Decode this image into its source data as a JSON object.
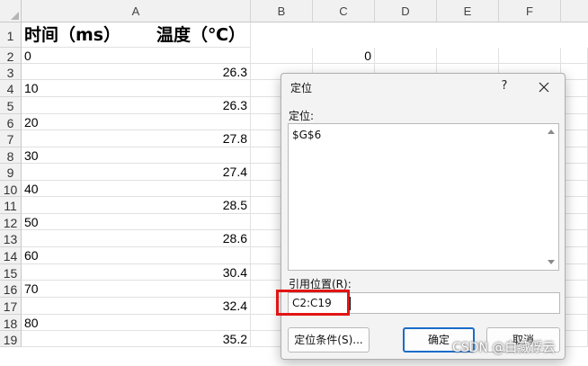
{
  "columns": [
    "A",
    "B",
    "C",
    "D",
    "E",
    "F"
  ],
  "rows": [
    "1",
    "2",
    "3",
    "4",
    "5",
    "6",
    "7",
    "8",
    "9",
    "10",
    "11",
    "12",
    "13",
    "14",
    "15",
    "16",
    "17",
    "18",
    "19"
  ],
  "cells": {
    "a1_time": "时间（ms）",
    "a1_temp": "温度（℃）",
    "a2": "0",
    "c2": "0",
    "a3": "26.3",
    "a4": "10",
    "a5": "26.3",
    "a6": "20",
    "a7": "27.8",
    "a8": "30",
    "a9": "27.4",
    "a10": "40",
    "a11": "28.5",
    "a12": "50",
    "a13": "28.6",
    "a14": "60",
    "a15": "30.4",
    "a16": "70",
    "a17": "32.4",
    "a18": "80",
    "a19": "35.2"
  },
  "dialog": {
    "title": "定位",
    "help": "?",
    "goto_label": "定位:",
    "goto_items": [
      "$G$6"
    ],
    "ref_label": "引用位置(R):",
    "ref_value": "C2:C19",
    "special_button": "定位条件(S)...",
    "ok_button": "确定",
    "cancel_button": "取消"
  },
  "watermark": "CSDN @白藏俘云",
  "colors": {
    "highlight": "#e21414",
    "accent": "#1a6cc9"
  }
}
